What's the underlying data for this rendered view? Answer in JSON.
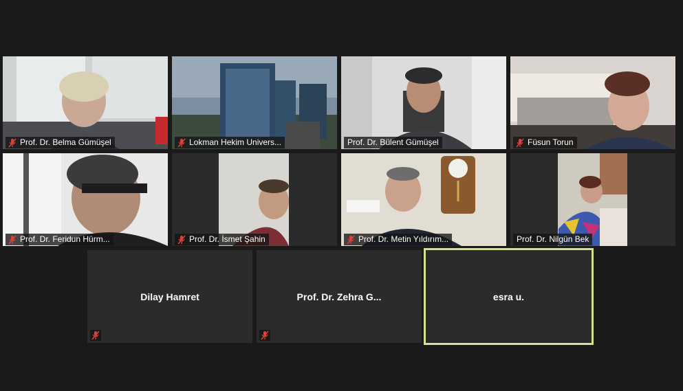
{
  "participants": [
    {
      "name": "Prof. Dr. Belma Gümüşel",
      "muted": true
    },
    {
      "name": "Lokman Hekim Univers...",
      "muted": true
    },
    {
      "name": "Prof. Dr. Bülent Gümüşel",
      "muted": false
    },
    {
      "name": "Füsun Torun",
      "muted": true
    },
    {
      "name": "Prof. Dr. Feridun Hürm...",
      "muted": true
    },
    {
      "name": "Prof. Dr. İsmet Şahin",
      "muted": true
    },
    {
      "name": "Prof. Dr. Metin Yıldırım...",
      "muted": true
    },
    {
      "name": "Prof. Dr. Nilgün Bek",
      "muted": false
    },
    {
      "name": "Dilay Hamret",
      "muted": true
    },
    {
      "name": "Prof. Dr. Zehra G...",
      "muted": true
    },
    {
      "name": "esra u.",
      "muted": false,
      "active_speaker": true
    }
  ],
  "colors": {
    "background": "#1a1a1a",
    "tile": "#2b2b2b",
    "active_border": "#d3e58b",
    "muted_icon": "#e0403a"
  }
}
